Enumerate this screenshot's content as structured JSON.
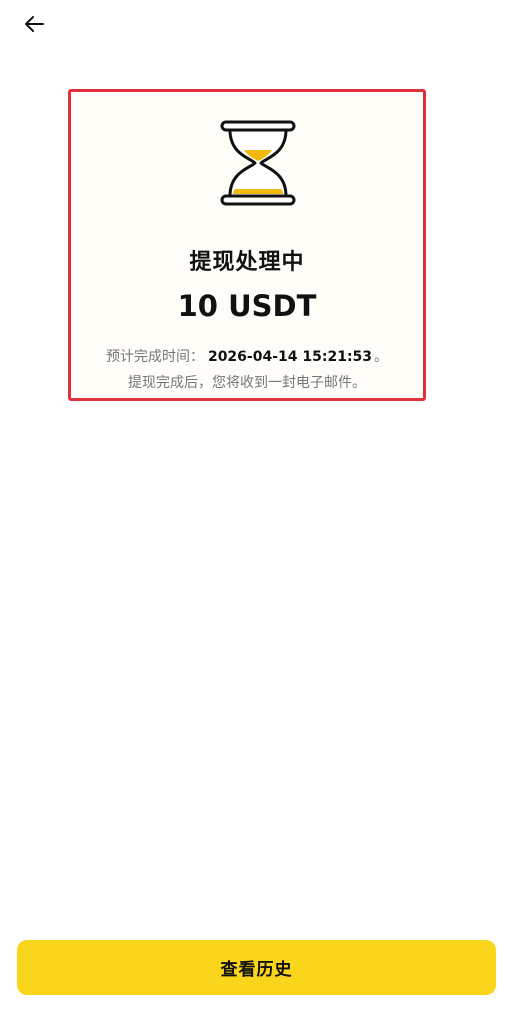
{
  "header": {
    "back_icon": "arrow-left-icon"
  },
  "status_card": {
    "icon": "hourglass-icon",
    "title": "提现处理中",
    "amount": "10 USDT",
    "eta_label": "预计完成时间：",
    "eta_time": "2026-04-14 15:21:53",
    "eta_suffix": "。",
    "note": "提现完成后，您将收到一封电子邮件。"
  },
  "footer": {
    "history_label": "查看历史"
  },
  "colors": {
    "accent": "#f9d51c",
    "hourglass_sand": "#f0b90b",
    "card_border": "#e0303c",
    "card_background": "#fffdf8"
  }
}
